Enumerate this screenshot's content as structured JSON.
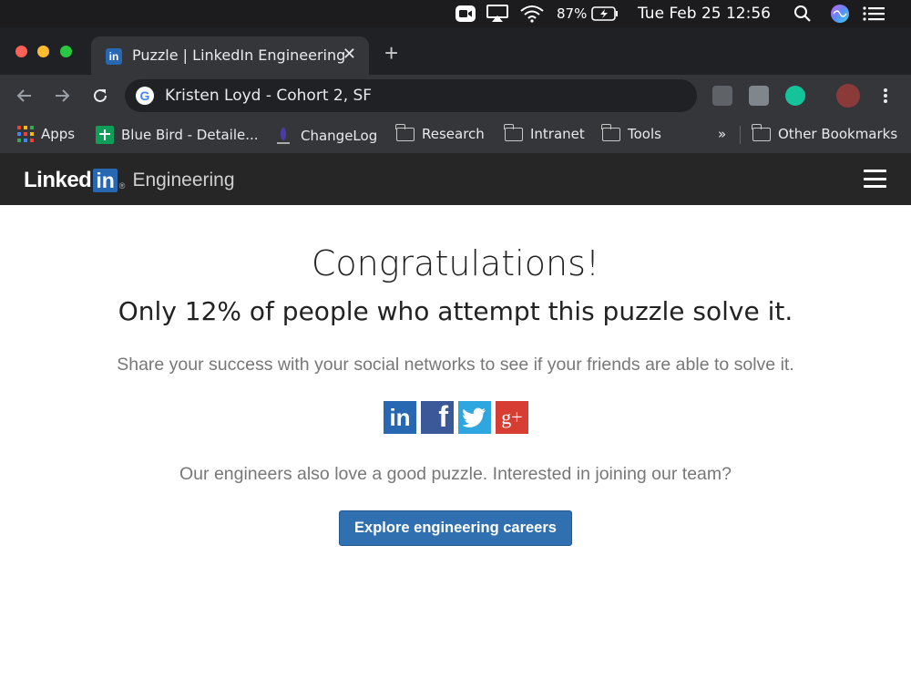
{
  "menubar": {
    "battery": "87%",
    "datetime": "Tue Feb 25  12:56"
  },
  "tab": {
    "favicon_text": "in",
    "title": "Puzzle | LinkedIn Engineering",
    "close_label": "✕",
    "new_tab_label": "+"
  },
  "omnibox": {
    "text": "Kristen Loyd - Cohort 2, SF"
  },
  "bookmarks": [
    {
      "label": "Apps"
    },
    {
      "label": "Blue Bird - Detaile..."
    },
    {
      "label": "ChangeLog"
    },
    {
      "label": "Research"
    },
    {
      "label": "Intranet"
    },
    {
      "label": "Tools"
    },
    {
      "label": "»"
    },
    {
      "label": "Other Bookmarks"
    }
  ],
  "site_header": {
    "logo_word": "Linked",
    "logo_box": "in",
    "logo_reg": "®",
    "section": "Engineering"
  },
  "main": {
    "heading": "Congratulations!",
    "subheading": "Only 12% of people who attempt this puzzle solve it.",
    "share_text": "Share your success with your social networks to see if your friends are able to solve it.",
    "social": [
      {
        "label": "in",
        "color": "#2867b2"
      },
      {
        "label": "f",
        "color": "#3b5998"
      },
      {
        "label": "twitter-icon",
        "color": "#2ea7e0"
      },
      {
        "label": "g+",
        "color": "#d73d32"
      }
    ],
    "team_text": "Our engineers also love a good puzzle. Interested in joining our team?",
    "cta_label": "Explore engineering careers"
  }
}
